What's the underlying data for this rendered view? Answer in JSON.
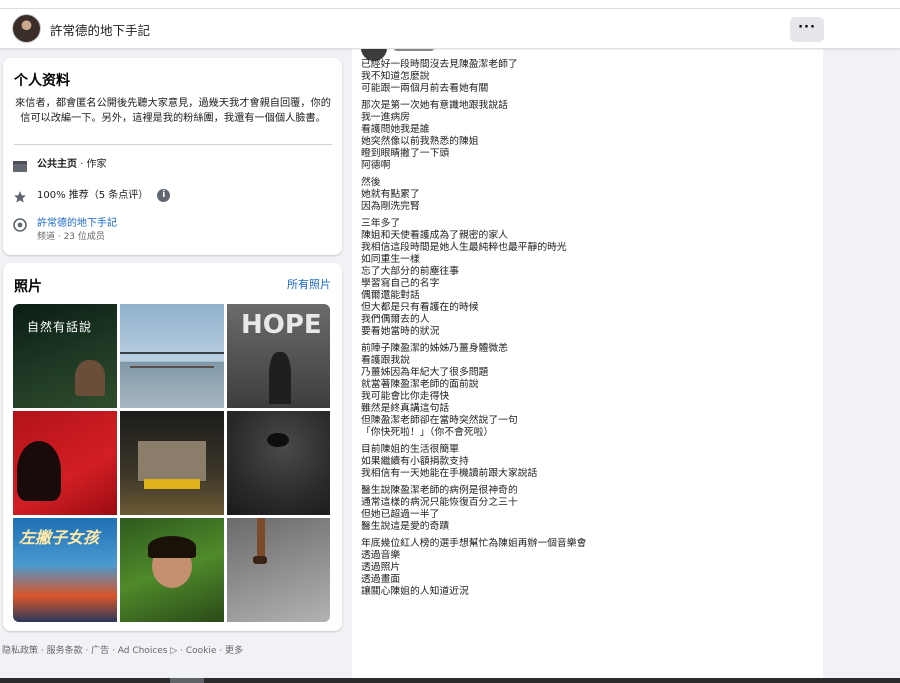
{
  "header": {
    "page_name": "許常德的地下手記",
    "more_label": "···"
  },
  "intro": {
    "title": "个人资料",
    "bio": "來信者，都會匿名公開後先聽大家意見，過幾天我才會親自回覆，你的信可以改編一下。另外，這裡是我的粉絲團，我還有一個個人臉書。",
    "category_label": "公共主页",
    "category_value": " · 作家",
    "recommend": "100% 推荐（5 条点评）",
    "info_icon": "i",
    "group_name": "許常德的地下手記",
    "group_meta": "频道 · 23 位成员"
  },
  "photos": {
    "title": "照片",
    "all_link": "所有照片",
    "captions": [
      "自然有話說",
      "HOPE",
      "左撇子女孩"
    ]
  },
  "footer": {
    "text": "隐私政策 · 服务条款 · 广告 · Ad Choices",
    "adchoices_icon": "▷",
    "text2": " · Cookie · 更多"
  },
  "post": {
    "paragraphs": [
      [
        "已經好一段時間沒去見陳盈潔老師了",
        "我不知道怎麼說",
        "可能跟一兩個月前去看她有關"
      ],
      [
        "那次是第一次她有意識地跟我說話",
        "我一進病房",
        "看護問她我是誰",
        "她突然像以前我熟悉的陳姐",
        "瞪到眼睛撇了一下頭",
        "阿德啊"
      ],
      [
        "然後",
        "她就有點累了",
        "因為剛洗完腎"
      ],
      [
        "三年多了",
        "陳姐和天使看護成為了親密的家人",
        "我相信這段時間是她人生最純粹也最平靜的時光",
        "如同重生一樣",
        "忘了大部分的前塵往事",
        "學習寫自己的名字",
        "偶爾還能對話",
        "但大都是只有看護在的時候",
        "我們偶爾去的人",
        "要看她當時的狀況"
      ],
      [
        "前陣子陳盈潔的姊姊乃薑身體微恙",
        "看護跟我說",
        "乃薑姊因為年紀大了很多問題",
        "就當著陳盈潔老師的面前說",
        "我可能會比你走得快",
        "雖然是終真講這句話",
        "但陳盈潔老師卻在當時突然說了一句",
        "「你快死啦！」（你不會死啦）"
      ],
      [
        "目前陳姐的生活很簡單",
        "如果繼續有小額捐款支持",
        "我相信有一天她能在手機讀前跟大家說話"
      ],
      [
        "醫生說陳盈潔老師的病例是很神奇的",
        "通常這樣的病況只能恢復百分之三十",
        "但她已超過一半了",
        "醫生說這是愛的奇蹟"
      ],
      [
        "年底幾位紅人榜的選手想幫忙為陳姐再辦一個音樂會",
        "透過音樂",
        "透過照片",
        "透過畫面",
        "讓關心陳姐的人知道近況"
      ]
    ]
  },
  "colors": {
    "link": "#1b6ac9",
    "card": "#ffffff",
    "background": "#f0f2f5",
    "muted": "#65676b"
  }
}
